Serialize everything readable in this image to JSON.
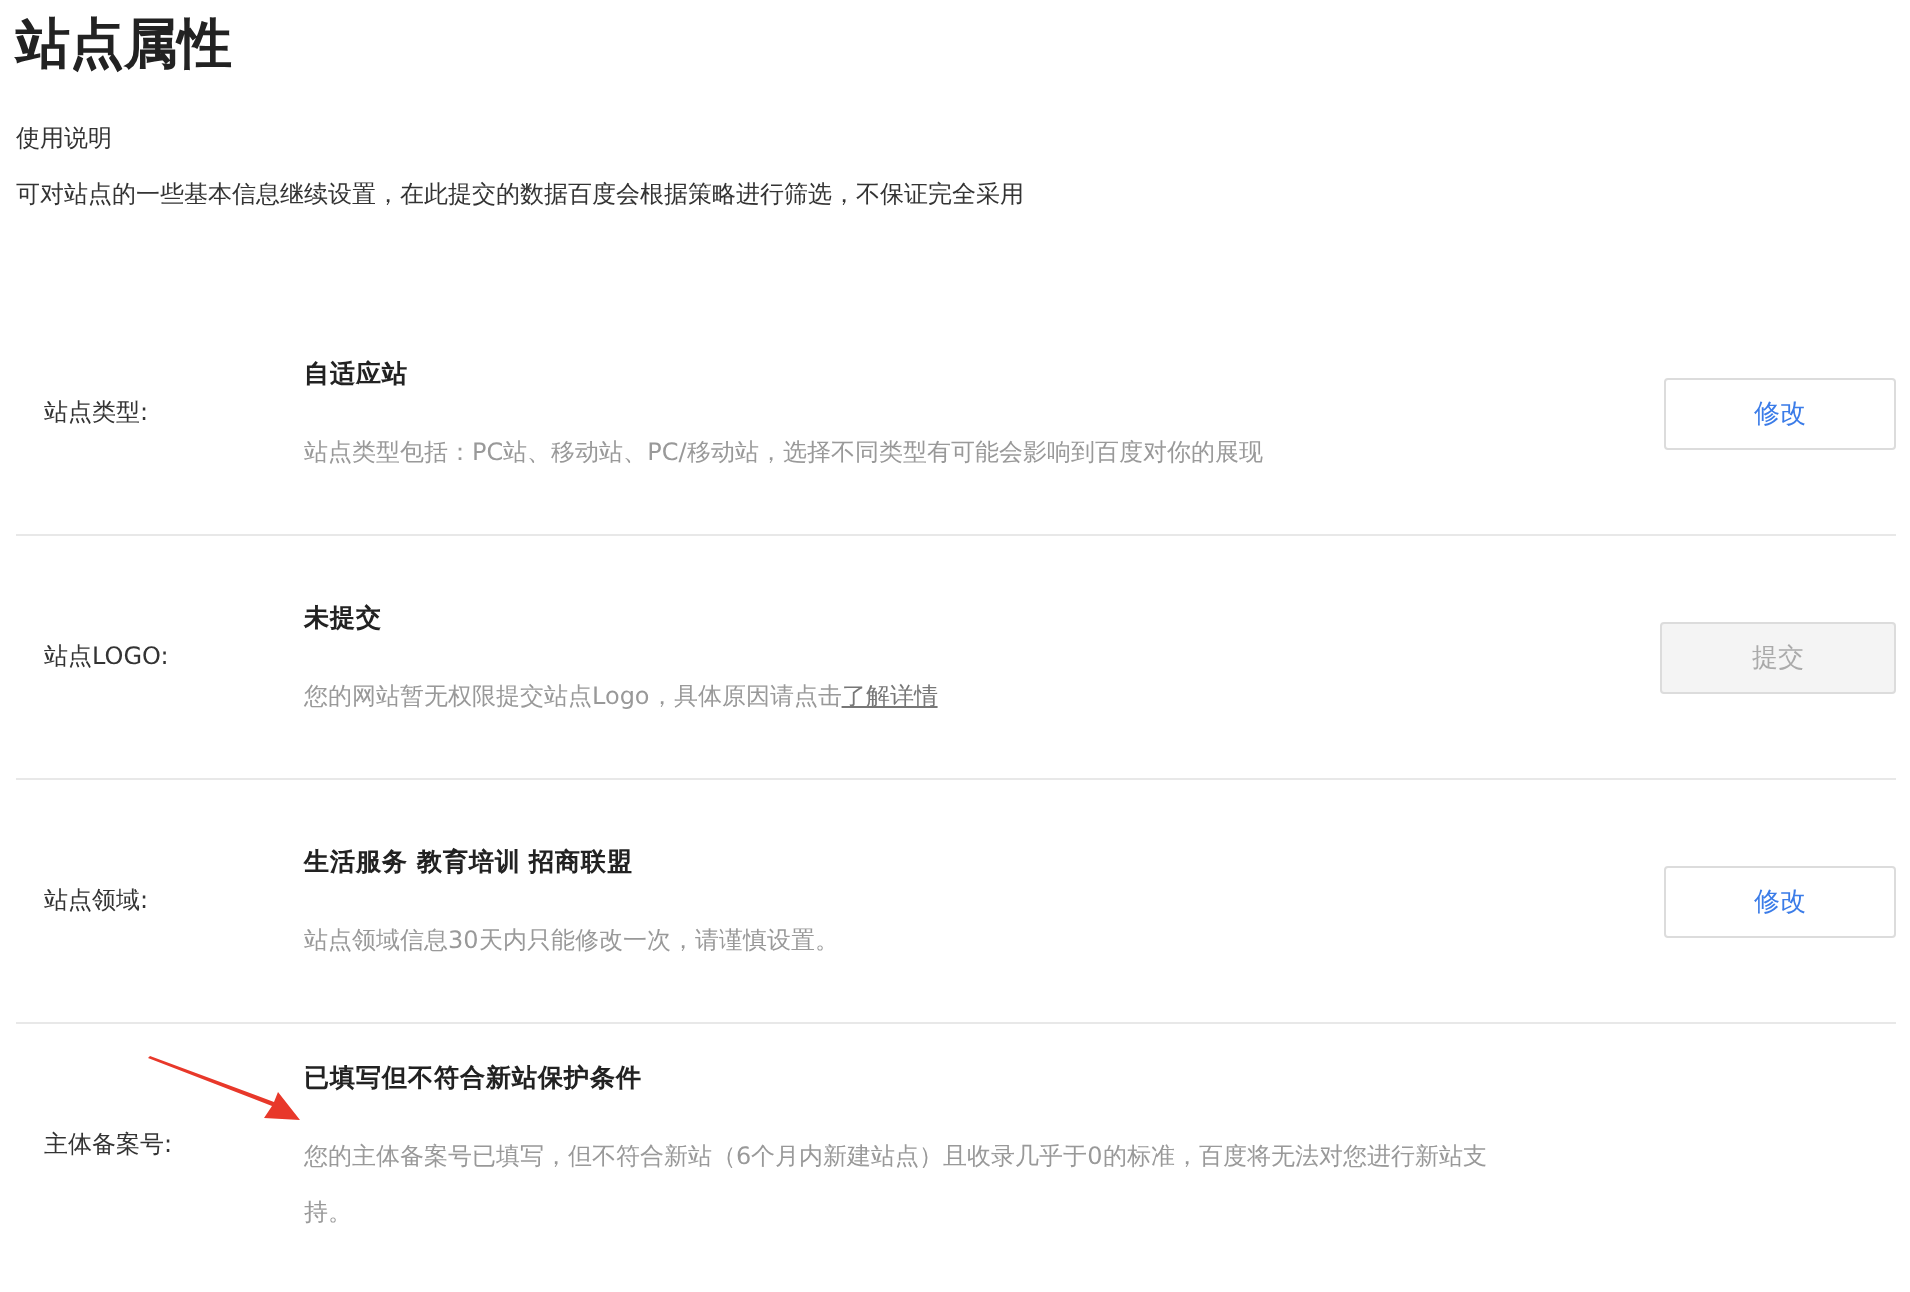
{
  "page": {
    "title": "站点属性",
    "subtitle": "使用说明",
    "description": "可对站点的一些基本信息继续设置，在此提交的数据百度会根据策略进行筛选，不保证完全采用"
  },
  "rows": [
    {
      "label": "站点类型:",
      "value": "自适应站",
      "description": "站点类型包括：PC站、移动站、PC/移动站，选择不同类型有可能会影响到百度对你的展现",
      "button": {
        "label": "修改",
        "disabled": false
      },
      "arrow": false
    },
    {
      "label": "站点LOGO:",
      "value": "未提交",
      "description": "您的网站暂无权限提交站点Logo，具体原因请点击",
      "link": "了解详情",
      "button": {
        "label": "提交",
        "disabled": true
      },
      "arrow": false
    },
    {
      "label": "站点领域:",
      "value": "生活服务 教育培训 招商联盟",
      "description": "站点领域信息30天内只能修改一次，请谨慎设置。",
      "button": {
        "label": "修改",
        "disabled": false
      },
      "arrow": false
    },
    {
      "label": "主体备案号:",
      "value": "已填写但不符合新站保护条件",
      "description": "您的主体备案号已填写，但不符合新站（6个月内新建站点）且收录几乎于0的标准，百度将无法对您进行新站支持。",
      "arrow": true
    }
  ]
}
